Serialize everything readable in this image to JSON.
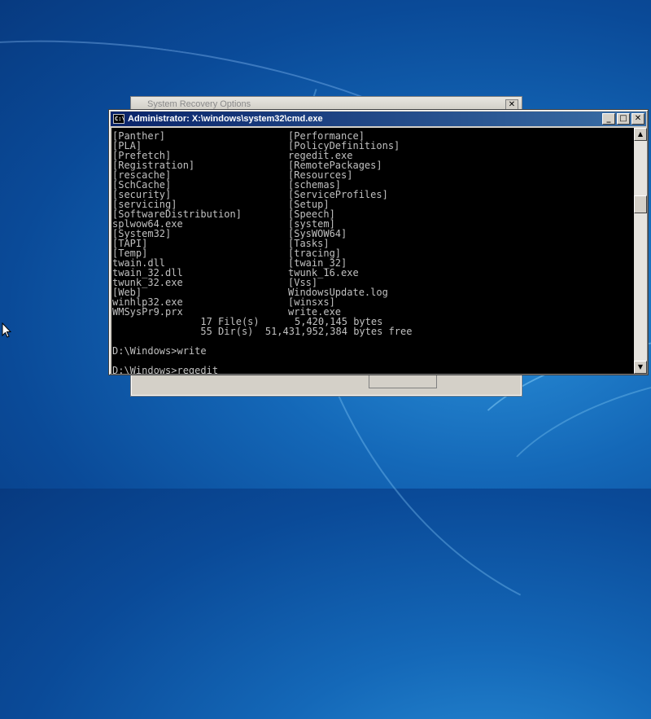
{
  "background_dialog": {
    "title": "System Recovery Options",
    "close_glyph": "✕"
  },
  "cmd_window": {
    "title": "Administrator: X:\\windows\\system32\\cmd.exe",
    "icon_text": "C:\\",
    "icon": "cmd-icon",
    "minimize_glyph": "_",
    "maximize_glyph": "□",
    "close_glyph": "✕",
    "lines": [
      {
        "c1": "[Panther]",
        "c2": "[Performance]"
      },
      {
        "c1": "[PLA]",
        "c2": "[PolicyDefinitions]"
      },
      {
        "c1": "[Prefetch]",
        "c2": "regedit.exe"
      },
      {
        "c1": "[Registration]",
        "c2": "[RemotePackages]"
      },
      {
        "c1": "[rescache]",
        "c2": "[Resources]"
      },
      {
        "c1": "[SchCache]",
        "c2": "[schemas]"
      },
      {
        "c1": "[security]",
        "c2": "[ServiceProfiles]"
      },
      {
        "c1": "[servicing]",
        "c2": "[Setup]"
      },
      {
        "c1": "[SoftwareDistribution]",
        "c2": "[Speech]"
      },
      {
        "c1": "splwow64.exe",
        "c2": "[system]"
      },
      {
        "c1": "[System32]",
        "c2": "[SysWOW64]"
      },
      {
        "c1": "[TAPI]",
        "c2": "[Tasks]"
      },
      {
        "c1": "[Temp]",
        "c2": "[tracing]"
      },
      {
        "c1": "twain.dll",
        "c2": "[twain_32]"
      },
      {
        "c1": "twain_32.dll",
        "c2": "twunk_16.exe"
      },
      {
        "c1": "twunk_32.exe",
        "c2": "[Vss]"
      },
      {
        "c1": "[Web]",
        "c2": "WindowsUpdate.log"
      },
      {
        "c1": "winhlp32.exe",
        "c2": "[winsxs]"
      },
      {
        "c1": "WMSysPr9.prx",
        "c2": "write.exe"
      },
      {
        "c1": "               17 File(s)      5,420,145 bytes",
        "c2": ""
      },
      {
        "c1": "               55 Dir(s)  51,431,952,384 bytes free",
        "c2": ""
      },
      {
        "c1": "",
        "c2": ""
      },
      {
        "c1": "D:\\Windows>write",
        "c2": ""
      },
      {
        "c1": "",
        "c2": ""
      },
      {
        "c1": "D:\\Windows>regedit",
        "c2": ""
      }
    ]
  },
  "scrollbar": {
    "up_glyph": "▲",
    "down_glyph": "▼",
    "scroll_position": 0.27
  }
}
